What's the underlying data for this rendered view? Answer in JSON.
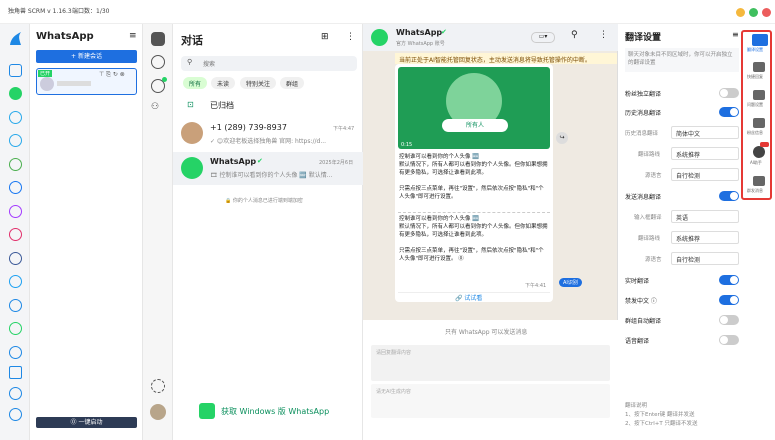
{
  "app": {
    "title": "独角兽 SCRM v 1.16.3",
    "port": "端口数：1/30"
  },
  "account_panel": {
    "title": "WhatsApp",
    "new_session": "+ 新建会话",
    "badge": "已开",
    "footer": "⓪ 一键启动"
  },
  "chat_list": {
    "title": "对话",
    "search_placeholder": "搜索",
    "filters": [
      "所有",
      "未读",
      "特别关注",
      "群组"
    ],
    "archived": "已归档",
    "items": [
      {
        "name": "+1 (289) 739-8937",
        "time": "下午4:47",
        "preview": "✓ 😊欢迎老板选择独角兽 官网: https://d..."
      },
      {
        "name": "WhatsApp",
        "time": "2025年2月6日",
        "preview": "🎞 控制谁可以看到你的个人头像 🆕 默认情..."
      }
    ],
    "encryption_note": "🔒 你的个人消息已进行端到端加密",
    "get_windows": "获取 Windows 版 WhatsApp"
  },
  "chat": {
    "name": "WhatsApp",
    "subtitle": "官方 WhatsApp 账号",
    "notice": "当前正处于AI智能托管回复状态，主动发送消息将导致托管操作的中断。",
    "pill": "所有人",
    "media_time": "0:15",
    "msg1": "控制谁可以看到你的个人头像 🆕\n默认情况下，所有人都可以看到你的个人头像。但你如果想拥有更多隐私，可选择让谁看到此项。\n\n只需点按三点菜单，再往\"设置\"，然后依次点按\"隐私\"和\"个人头像\"即可进行设置。",
    "msg2": "控制谁可以看到你的个人头像 🆕\n默认情况下，所有人都可以看到你的个人头像。但你如果想拥有更多隐私，可选择让谁看到此项。\n\n只需点按三点菜单，再往\"设置\"，然后依次点按\"隐私\"和\"个人头像\"即可进行设置。 ⓪",
    "msg_time": "下午4:41",
    "ai_badge": "AI识别",
    "try_link": "🔗 试试看",
    "only_official": "只有 WhatsApp 可以发送消息",
    "translate_placeholder": "请回复翻译内容",
    "ai_placeholder": "请无AI生成内容"
  },
  "settings": {
    "title": "翻译设置",
    "desc": "聊天对象未目不同区域时，你可以开启独立的翻译设置",
    "rows": [
      {
        "label": "粉丝独立翻译",
        "toggle": false
      },
      {
        "label": "历史消息翻译",
        "toggle": true
      }
    ],
    "hist_engine_label": "历史消息翻译",
    "hist_engine": "简体中文",
    "hist_route_label": "翻译路线",
    "hist_route": "系统推荐",
    "hist_src_label": "源语言",
    "hist_src": "自行检测",
    "send_label": "发送消息翻译",
    "input_lang_label": "输入框翻译",
    "input_lang": "英语",
    "send_route_label": "翻译路线",
    "send_route": "系统推荐",
    "send_src_label": "源语言",
    "send_src": "自行检测",
    "realtime": "实时翻译",
    "block_cn": "禁发中文 ⓘ",
    "group_auto": "群组自动翻译",
    "voice": "语音翻译",
    "help_title": "翻译说明",
    "help1": "1、按下Enter键 翻译并发送",
    "help2": "2、按下Ctrl+T 只翻译不发送",
    "help2_link": "Ctrl+T"
  },
  "rightbar": {
    "items": [
      "翻译设置",
      "快捷回复",
      "问题设置",
      "粉丝信息",
      "AI助手",
      "群发消息"
    ]
  },
  "colors": {
    "brand": "#1e6fe0",
    "whatsapp": "#25d366",
    "alert": "#e53935"
  }
}
